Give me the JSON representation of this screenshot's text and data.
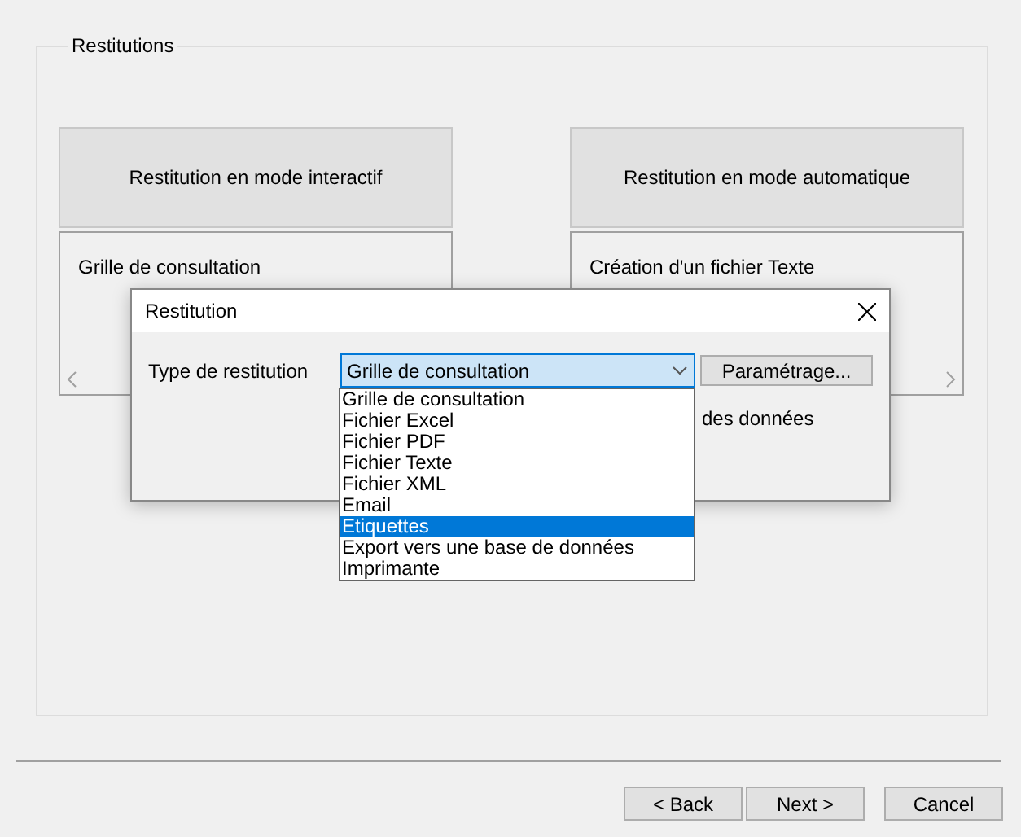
{
  "group": {
    "title": "Restitutions"
  },
  "panels": [
    {
      "mode_button": "Restitution en mode interactif",
      "list_text": "Grille de consultation",
      "kind": "left"
    },
    {
      "mode_button": "Restitution en mode automatique",
      "list_text": "Création d'un fichier Texte",
      "kind": "right"
    }
  ],
  "dialog": {
    "title": "Restitution",
    "field_label": "Type de restitution",
    "combo_value": "Grille de consultation",
    "settings_button": "Paramétrage...",
    "partial_text": "des données",
    "options": [
      {
        "label": "Grille de consultation",
        "selected": false
      },
      {
        "label": "Fichier Excel",
        "selected": false
      },
      {
        "label": "Fichier PDF",
        "selected": false
      },
      {
        "label": "Fichier Texte",
        "selected": false
      },
      {
        "label": "Fichier XML",
        "selected": false
      },
      {
        "label": "Email",
        "selected": false
      },
      {
        "label": "Etiquettes",
        "selected": true
      },
      {
        "label": "Export vers une base de données",
        "selected": false
      },
      {
        "label": "Imprimante",
        "selected": false
      }
    ]
  },
  "buttons": [
    "< Back",
    "Next >",
    "Cancel"
  ]
}
